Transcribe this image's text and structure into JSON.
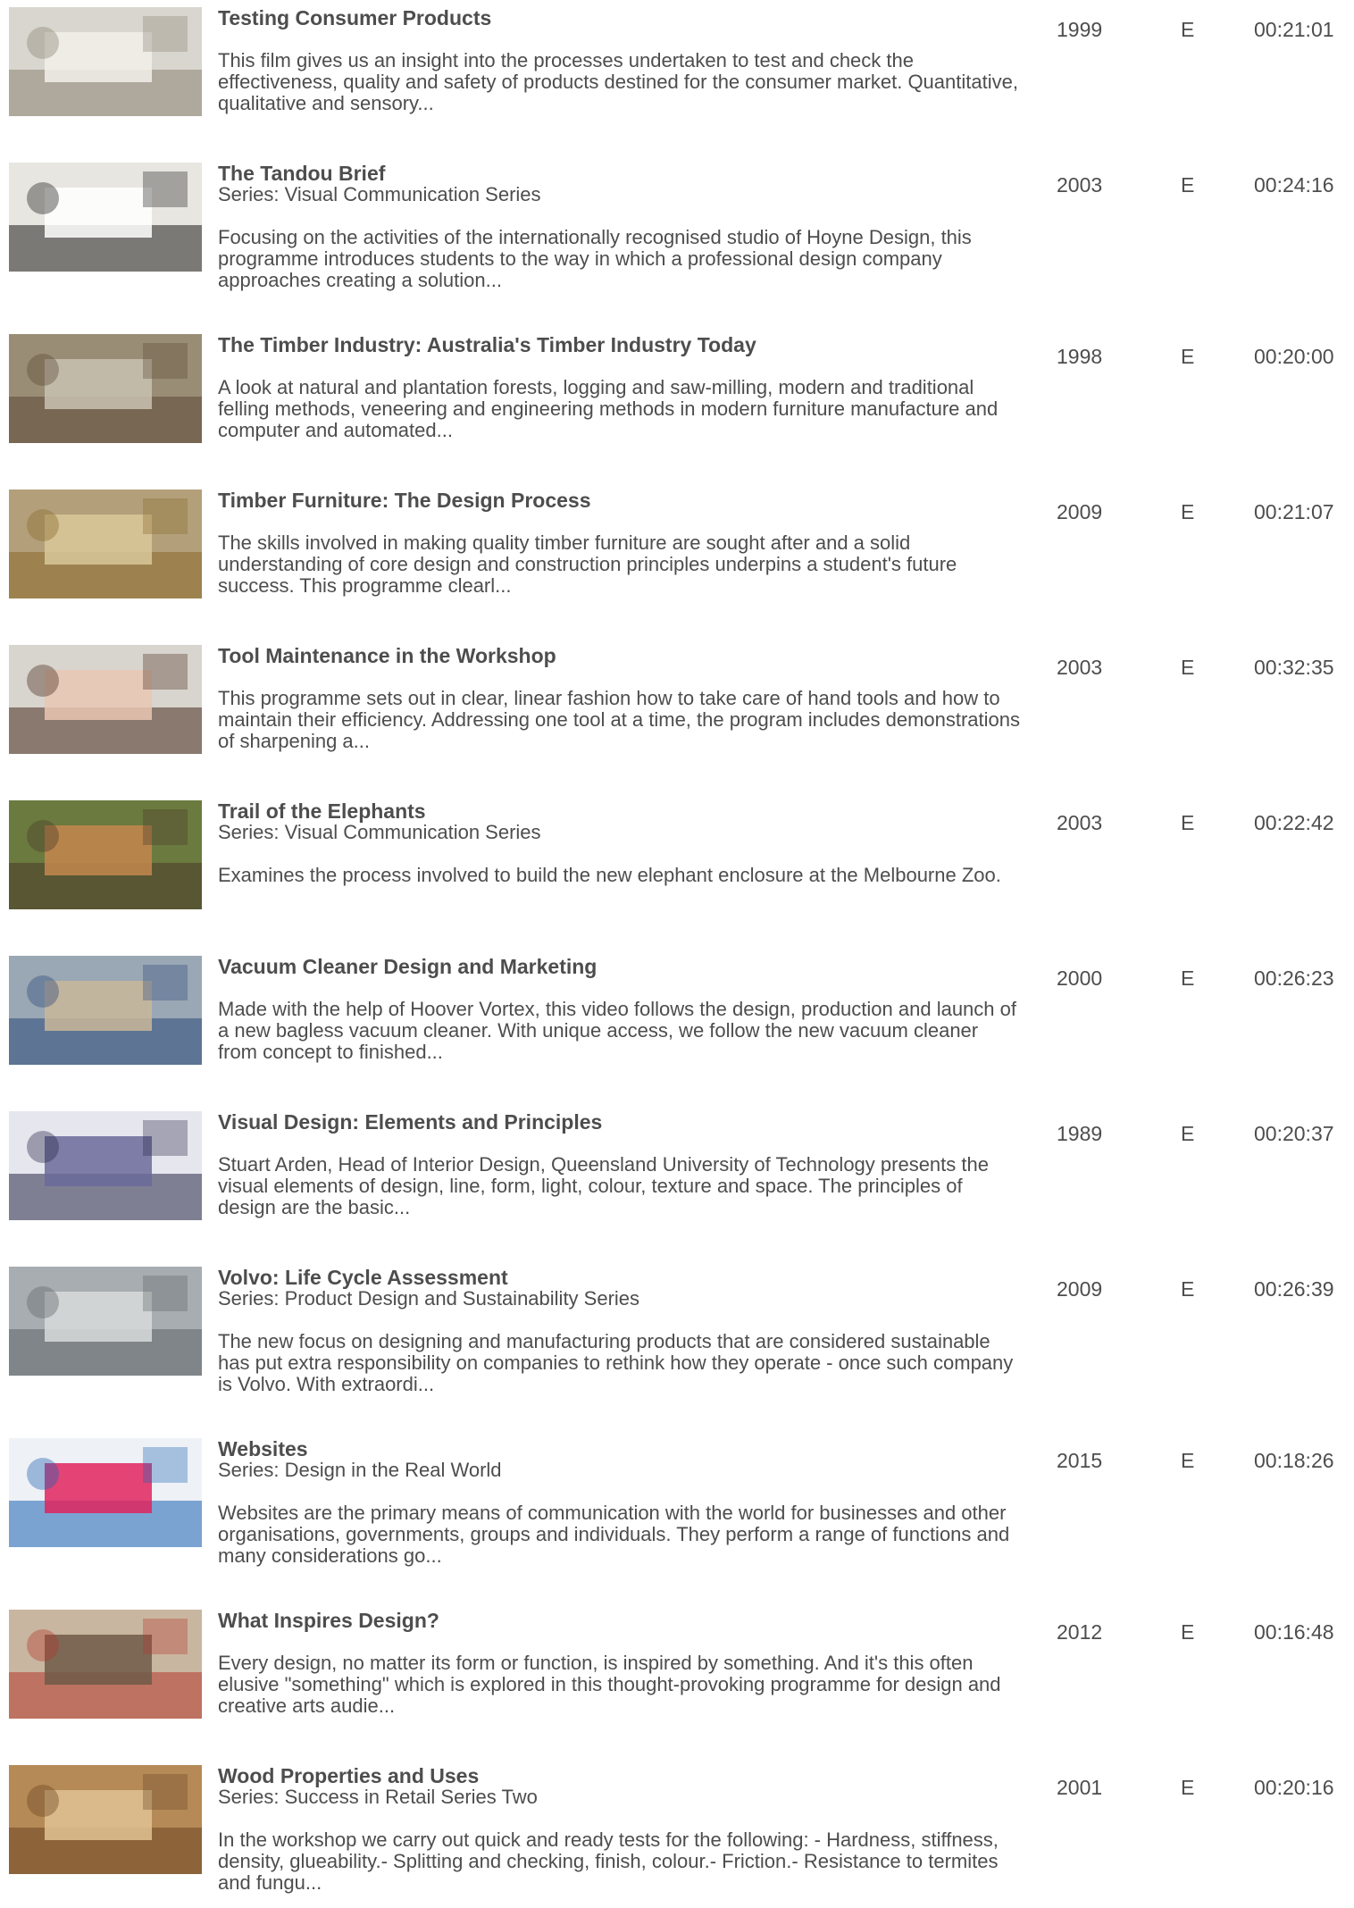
{
  "items": [
    {
      "title": "Testing Consumer Products",
      "series": "",
      "description": "This film gives us an insight into the processes undertaken to test and check the effectiveness, quality and safety of products destined for the consumer market. Quantitative, qualitative and sensory...",
      "year": "1999",
      "lang": "E",
      "duration": "00:21:01",
      "thumb_icon": "lab-samples-thumbnail",
      "thumb_colors": [
        "#d9d6cf",
        "#8c8474",
        "#f2f0ea"
      ]
    },
    {
      "title": "The Tandou Brief",
      "series": "Series: Visual Communication Series",
      "description": "Focusing on the activities of the internationally recognised studio of Hoyne Design, this programme introduces students to the way in which a professional design company approaches creating a solution...",
      "year": "2003",
      "lang": "E",
      "duration": "00:24:16",
      "thumb_icon": "brochure-thumbnail",
      "thumb_colors": [
        "#e8e6e0",
        "#1f1f1f",
        "#ffffff"
      ]
    },
    {
      "title": "The Timber Industry: Australia's Timber Industry Today",
      "series": "",
      "description": "A look at natural and plantation forests, logging and saw-milling, modern and traditional felling methods, veneering and engineering methods in modern furniture manufacture and computer and automated...",
      "year": "1998",
      "lang": "E",
      "duration": "00:20:00",
      "thumb_icon": "forest-logging-thumbnail",
      "thumb_colors": [
        "#9a8d76",
        "#5c4a36",
        "#c9c2b2"
      ]
    },
    {
      "title": "Timber Furniture: The Design Process",
      "series": "",
      "description": "The skills involved in making quality timber furniture are sought after and a solid understanding of core design and construction principles underpins a student's future success. This programme clearl...",
      "year": "2009",
      "lang": "E",
      "duration": "00:21:07",
      "thumb_icon": "timber-model-thumbnail",
      "thumb_colors": [
        "#b3a07a",
        "#8a6a2c",
        "#d9c89a"
      ]
    },
    {
      "title": "Tool Maintenance in the Workshop",
      "series": "",
      "description": "This programme sets out in clear, linear fashion how to take care of hand tools and how to maintain their efficiency. Addressing one tool at a time, the program includes demonstrations of sharpening a...",
      "year": "2003",
      "lang": "E",
      "duration": "00:32:35",
      "thumb_icon": "woodworking-thumbnail",
      "thumb_colors": [
        "#d8d4ce",
        "#4a2e1f",
        "#e9c7b3"
      ]
    },
    {
      "title": "Trail of the Elephants",
      "series": "Series: Visual Communication Series",
      "description": "Examines the process involved to build the new elephant enclosure at the Melbourne Zoo.",
      "year": "2003",
      "lang": "E",
      "duration": "00:22:42",
      "thumb_icon": "presenter-thumbnail",
      "thumb_colors": [
        "#6b7a3e",
        "#4a3a2a",
        "#c4874f"
      ]
    },
    {
      "title": "Vacuum Cleaner Design and Marketing",
      "series": "",
      "description": "Made with the help of Hoover Vortex, this video follows the design, production and launch of a new bagless vacuum cleaner. With unique access, we follow the new vacuum cleaner from concept to finished...",
      "year": "2000",
      "lang": "E",
      "duration": "00:26:23",
      "thumb_icon": "vacuum-cleaner-thumbnail",
      "thumb_colors": [
        "#9aa7b4",
        "#2d4a7a",
        "#c9b79a"
      ]
    },
    {
      "title": "Visual Design: Elements and Principles",
      "series": "",
      "description": "Stuart Arden, Head of Interior Design, Queensland University of Technology presents the visual elements of design, line, form, light, colour, texture and space. The principles of design are the basic...",
      "year": "1989",
      "lang": "E",
      "duration": "00:20:37",
      "thumb_icon": "design-blocks-thumbnail",
      "thumb_colors": [
        "#e6e6ee",
        "#2a2a4a",
        "#6a6a9a"
      ]
    },
    {
      "title": "Volvo: Life Cycle Assessment",
      "series": "Series: Product Design and Sustainability Series",
      "description": "The new focus on designing and manufacturing products that are considered sustainable has put extra responsibility on companies to rethink how they operate - once such company is Volvo. With extraordi...",
      "year": "2009",
      "lang": "E",
      "duration": "00:26:39",
      "thumb_icon": "car-factory-thumbnail",
      "thumb_colors": [
        "#a7adb0",
        "#5e6468",
        "#d7dadb"
      ]
    },
    {
      "title": "Websites",
      "series": "Series: Design in the Real World",
      "description": "Websites are the primary means of communication with the world for businesses and other organisations, governments, groups and individuals. They perform a range of functions and many considerations go...",
      "year": "2015",
      "lang": "E",
      "duration": "00:18:26",
      "thumb_icon": "social-icons-thumbnail",
      "thumb_colors": [
        "#eef1f6",
        "#1e63b5",
        "#e0245e"
      ]
    },
    {
      "title": "What Inspires Design?",
      "series": "",
      "description": "Every design, no matter its form or function, is inspired by something. And it's this often elusive \"something\" which is explored in this thought-provoking programme for design and creative arts audie...",
      "year": "2012",
      "lang": "E",
      "duration": "00:16:48",
      "thumb_icon": "designers-thumbnail",
      "thumb_colors": [
        "#c9b6a0",
        "#b43a2e",
        "#6e5a48"
      ]
    },
    {
      "title": "Wood Properties and Uses",
      "series": "Series: Success in Retail Series Two",
      "description": "In the workshop we carry out quick and ready tests for the following: - Hardness, stiffness, density, glueability.- Splitting and checking, finish, colour.- Friction.- Resistance to termites and fungu...",
      "year": "2001",
      "lang": "E",
      "duration": "00:20:16",
      "thumb_icon": "timber-planks-thumbnail",
      "thumb_colors": [
        "#b58a56",
        "#6b4424",
        "#e0c293"
      ]
    }
  ]
}
